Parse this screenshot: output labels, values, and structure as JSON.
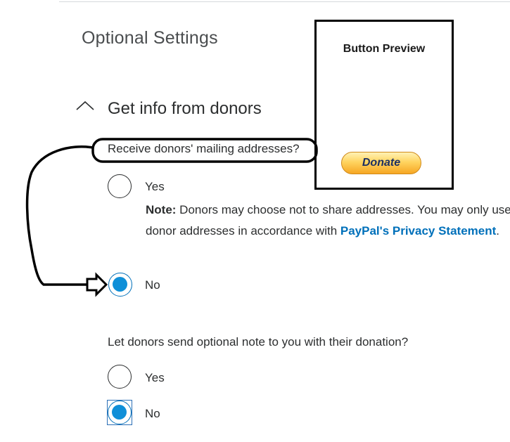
{
  "settings": {
    "section_title": "Optional Settings",
    "group_title": "Get info from donors",
    "question_addresses": "Receive donors' mailing addresses?",
    "addresses_options": {
      "yes_label": "Yes",
      "no_label": "No",
      "selected": "No"
    },
    "note_prefix": "Note:",
    "note_text": " Donors may choose not to share addresses. You may only use donor addresses in accordance with ",
    "note_link": "PayPal's Privacy Statement",
    "note_suffix": ".",
    "question_note": "Let donors send optional note to you with their donation?",
    "note_options": {
      "yes_label": "Yes",
      "no_label": "No",
      "selected": "No"
    }
  },
  "preview": {
    "title": "Button Preview",
    "donate_label": "Donate"
  },
  "colors": {
    "accent": "#0070ba",
    "radio_fill": "#0f8fd8",
    "donate_gold": "#ffc439"
  }
}
